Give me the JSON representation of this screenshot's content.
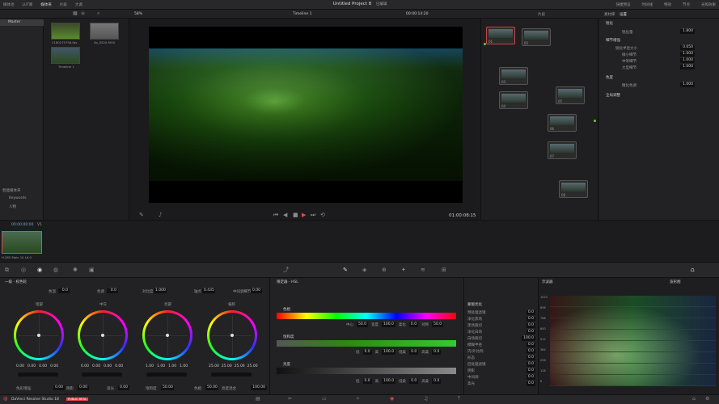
{
  "topbar": {
    "left_items": [
      "媒体池",
      "LUT库",
      "媒体夹",
      "片段",
      "大调"
    ],
    "project_title": "Untitled Project 8",
    "edit_state": "已编辑",
    "right_items": [
      "快捷预览",
      "时间线",
      "特效",
      "节点",
      "光照效果"
    ]
  },
  "viewer_bar": {
    "zoom": "58%",
    "timeline_name": "Timeline 1",
    "timecode": "00:00:14:20",
    "right_label": "片段"
  },
  "right_panel_tabs": {
    "tab1": "素材库",
    "tab2": "设置"
  },
  "media_pool": {
    "bin_label": "Master",
    "clips": [
      {
        "name": "2180275758.fbx"
      },
      {
        "name": "5p_0520.MOV"
      },
      {
        "name": "Timeline 1"
      }
    ],
    "smart_bins": "智能媒体夹",
    "keywords": "Keywords",
    "people": "人物"
  },
  "viewer": {
    "timecode": "01:00:08:15"
  },
  "nodes": [
    {
      "id": "01"
    },
    {
      "id": "02"
    },
    {
      "id": "03"
    },
    {
      "id": "04"
    },
    {
      "id": "05"
    },
    {
      "id": "06"
    },
    {
      "id": "07"
    },
    {
      "id": "08"
    },
    {
      "id": "09"
    }
  ],
  "effects_panel": {
    "section1": "锐化",
    "rows1": [
      {
        "label": "锐化量",
        "value": "1.800"
      }
    ],
    "section2": "细节增强",
    "rows2": [
      {
        "label": "锐化半径大小",
        "value": "0.050"
      },
      {
        "label": "微小细节",
        "value": "1.000"
      },
      {
        "label": "中等细节",
        "value": "1.000"
      },
      {
        "label": "大型细节",
        "value": "1.000"
      }
    ],
    "section3": "色度",
    "rows3": [
      {
        "label": "精化色调",
        "value": "1.000"
      }
    ],
    "section4": "全局调整"
  },
  "timeline": {
    "track_label": "V1",
    "start_tc": "00:00:00:00",
    "clip_name": "H.265 Main 10 L6.0"
  },
  "wheels_panel": {
    "title": "一级 - 校色轮",
    "top_params": [
      {
        "label": "色温",
        "value": "0.0"
      },
      {
        "label": "色调",
        "value": "0.0"
      },
      {
        "label": "对比度",
        "value": "1.000"
      },
      {
        "label": "轴点",
        "value": "0.435"
      },
      {
        "label": "中间调细节",
        "value": "0.00"
      }
    ],
    "wheels": [
      {
        "name": "暗部",
        "vals": [
          "0.00",
          "0.00",
          "0.00",
          "0.00"
        ]
      },
      {
        "name": "中灰",
        "vals": [
          "0.00",
          "0.00",
          "0.00",
          "0.00"
        ]
      },
      {
        "name": "亮部",
        "vals": [
          "1.00",
          "1.00",
          "1.00",
          "1.00"
        ]
      },
      {
        "name": "偏移",
        "vals": [
          "25.00",
          "25.00",
          "25.00",
          "25.00"
        ]
      }
    ],
    "bottom_params": [
      {
        "label": "色彩增强",
        "value": "0.00"
      },
      {
        "label": "阴影",
        "value": "0.00"
      },
      {
        "label": "高光",
        "value": "0.00"
      },
      {
        "label": "饱和度",
        "value": "50.00"
      },
      {
        "label": "色相",
        "value": "50.00"
      },
      {
        "label": "亮度混合",
        "value": "100.00"
      }
    ]
  },
  "curves_panel": {
    "title": "限定器 - HSL",
    "hue_label": "色相",
    "hue_vals": [
      {
        "label": "中心",
        "value": "50.0"
      },
      {
        "label": "宽度",
        "value": "100.0"
      },
      {
        "label": "柔化",
        "value": "0.0"
      },
      {
        "label": "对称",
        "value": "50.0"
      }
    ],
    "sat_label": "饱和度",
    "sat_vals": [
      {
        "label": "低",
        "value": "0.0"
      },
      {
        "label": "高",
        "value": "100.0"
      },
      {
        "label": "低柔",
        "value": "0.0"
      },
      {
        "label": "高柔",
        "value": "0.0"
      }
    ],
    "lum_label": "亮度",
    "lum_vals": [
      {
        "label": "低",
        "value": "0.0"
      },
      {
        "label": "高",
        "value": "100.0"
      },
      {
        "label": "低柔",
        "value": "0.0"
      },
      {
        "label": "高柔",
        "value": "0.0"
      }
    ]
  },
  "matte_panel": {
    "title": "蒙版优化",
    "rows": [
      {
        "label": "预处理滤镜",
        "value": "0.0"
      },
      {
        "label": "净化黑场",
        "value": "0.0"
      },
      {
        "label": "黑场裁切",
        "value": "0.0"
      },
      {
        "label": "净化白场",
        "value": "0.0"
      },
      {
        "label": "白场裁切",
        "value": "100.0"
      },
      {
        "label": "模糊半径",
        "value": "0.0"
      },
      {
        "label": "内/外比例",
        "value": "0.0"
      },
      {
        "label": "形态",
        "value": "0.0"
      },
      {
        "label": "后处理滤镜",
        "value": "0.0"
      },
      {
        "label": "阴影",
        "value": "0.0"
      },
      {
        "label": "中间调",
        "value": "0.0"
      },
      {
        "label": "高光",
        "value": "0.0"
      }
    ]
  },
  "scope": {
    "title": "示波器",
    "mode": "波形图",
    "ticks": [
      "1023",
      "896",
      "768",
      "640",
      "512",
      "384",
      "256",
      "128",
      "0"
    ]
  },
  "status": {
    "app": "DaVinci Resolve Studio 18",
    "badge": "PUBLIC BETA"
  },
  "colors": {
    "accent": "#e64a4a",
    "bg": "#1c1c1e",
    "panel": "#28282a"
  }
}
